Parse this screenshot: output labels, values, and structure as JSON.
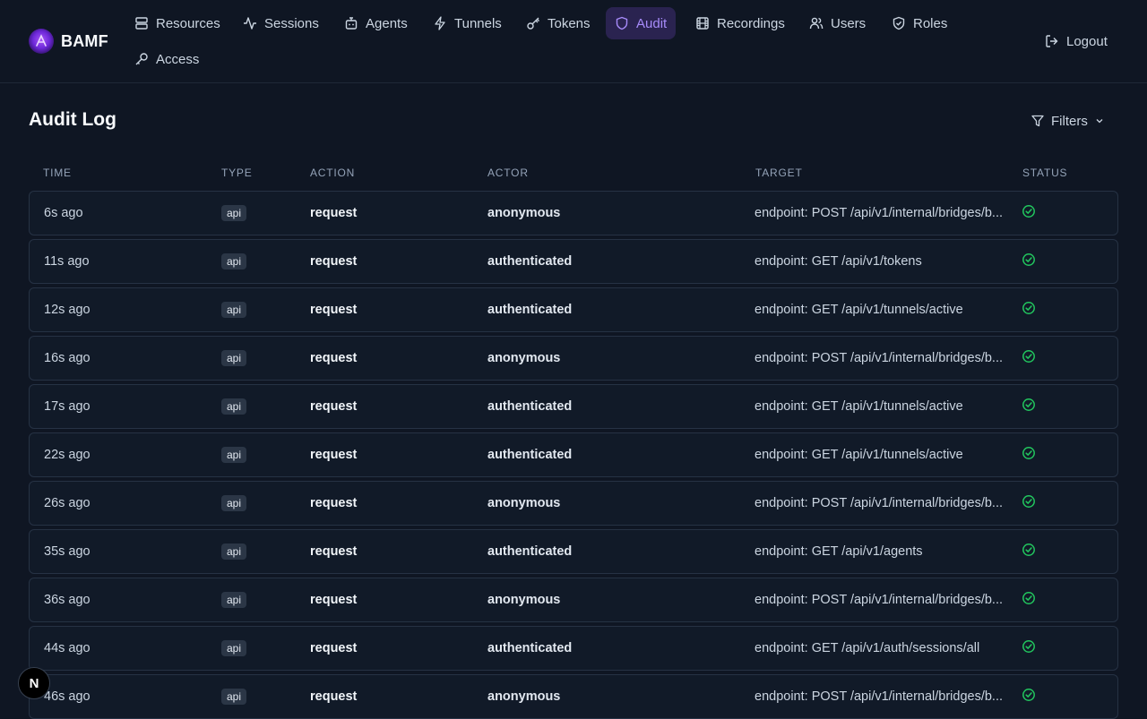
{
  "brand": {
    "name": "BAMF"
  },
  "nav": [
    {
      "label": "Resources",
      "icon": "server-icon"
    },
    {
      "label": "Sessions",
      "icon": "activity-icon"
    },
    {
      "label": "Agents",
      "icon": "bot-icon"
    },
    {
      "label": "Tunnels",
      "icon": "zap-icon"
    },
    {
      "label": "Tokens",
      "icon": "key-icon"
    },
    {
      "label": "Audit",
      "icon": "shield-icon",
      "active": true
    },
    {
      "label": "Recordings",
      "icon": "film-icon"
    },
    {
      "label": "Users",
      "icon": "users-icon"
    },
    {
      "label": "Roles",
      "icon": "shield-check-icon"
    },
    {
      "label": "Access",
      "icon": "key-round-icon"
    }
  ],
  "logout_label": "Logout",
  "page": {
    "title": "Audit Log",
    "filters_label": "Filters"
  },
  "table": {
    "columns": [
      "TIME",
      "TYPE",
      "ACTION",
      "ACTOR",
      "TARGET",
      "STATUS"
    ],
    "rows": [
      {
        "time": "6s ago",
        "type": "api",
        "action": "request",
        "actor": "anonymous",
        "target": "endpoint: POST /api/v1/internal/bridges/b...",
        "status": "success"
      },
      {
        "time": "11s ago",
        "type": "api",
        "action": "request",
        "actor": "authenticated",
        "target": "endpoint: GET /api/v1/tokens",
        "status": "success"
      },
      {
        "time": "12s ago",
        "type": "api",
        "action": "request",
        "actor": "authenticated",
        "target": "endpoint: GET /api/v1/tunnels/active",
        "status": "success"
      },
      {
        "time": "16s ago",
        "type": "api",
        "action": "request",
        "actor": "anonymous",
        "target": "endpoint: POST /api/v1/internal/bridges/b...",
        "status": "success"
      },
      {
        "time": "17s ago",
        "type": "api",
        "action": "request",
        "actor": "authenticated",
        "target": "endpoint: GET /api/v1/tunnels/active",
        "status": "success"
      },
      {
        "time": "22s ago",
        "type": "api",
        "action": "request",
        "actor": "authenticated",
        "target": "endpoint: GET /api/v1/tunnels/active",
        "status": "success"
      },
      {
        "time": "26s ago",
        "type": "api",
        "action": "request",
        "actor": "anonymous",
        "target": "endpoint: POST /api/v1/internal/bridges/b...",
        "status": "success"
      },
      {
        "time": "35s ago",
        "type": "api",
        "action": "request",
        "actor": "authenticated",
        "target": "endpoint: GET /api/v1/agents",
        "status": "success"
      },
      {
        "time": "36s ago",
        "type": "api",
        "action": "request",
        "actor": "anonymous",
        "target": "endpoint: POST /api/v1/internal/bridges/b...",
        "status": "success"
      },
      {
        "time": "44s ago",
        "type": "api",
        "action": "request",
        "actor": "authenticated",
        "target": "endpoint: GET /api/v1/auth/sessions/all",
        "status": "success"
      },
      {
        "time": "46s ago",
        "type": "api",
        "action": "request",
        "actor": "anonymous",
        "target": "endpoint: POST /api/v1/internal/bridges/b...",
        "status": "success"
      }
    ]
  },
  "dev_badge": {
    "label": "N"
  },
  "colors": {
    "accent": "#a78bfa",
    "active_bg": "#2a2350",
    "success": "#22c55e",
    "background": "#0f1623"
  }
}
